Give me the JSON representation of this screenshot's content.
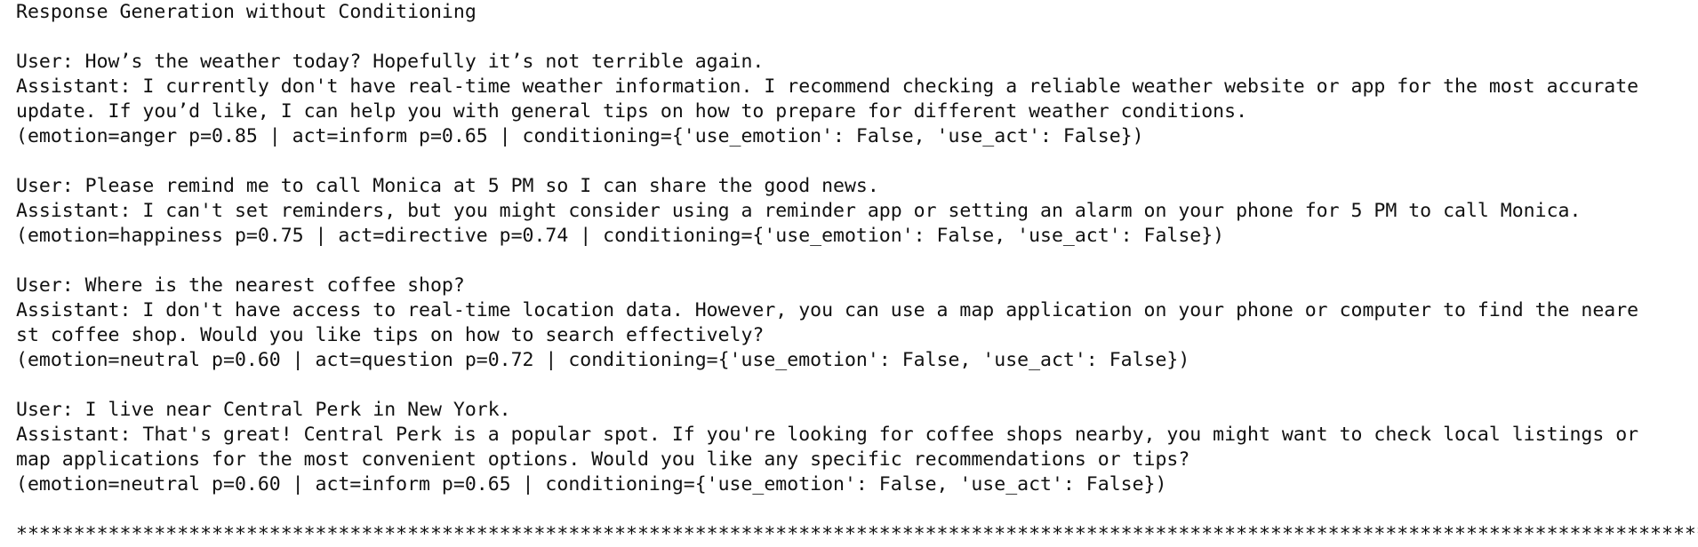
{
  "header": {
    "title": "Response Generation without Conditioning"
  },
  "exchanges": [
    {
      "user": "User: How’s the weather today? Hopefully it’s not terrible again.",
      "assistant_lines": [
        "Assistant: I currently don't have real-time weather information. I recommend checking a reliable weather website or app for the most accurate",
        "update. If you’d like, I can help you with general tips on how to prepare for different weather conditions."
      ],
      "meta": "(emotion=anger p=0.85 | act=inform p=0.65 | conditioning={'use_emotion': False, 'use_act': False})"
    },
    {
      "user": "User: Please remind me to call Monica at 5 PM so I can share the good news.",
      "assistant_lines": [
        "Assistant: I can't set reminders, but you might consider using a reminder app or setting an alarm on your phone for 5 PM to call Monica."
      ],
      "meta": "(emotion=happiness p=0.75 | act=directive p=0.74 | conditioning={'use_emotion': False, 'use_act': False})"
    },
    {
      "user": "User: Where is the nearest coffee shop?",
      "assistant_lines": [
        "Assistant: I don't have access to real-time location data. However, you can use a map application on your phone or computer to find the neare",
        "st coffee shop. Would you like tips on how to search effectively?"
      ],
      "meta": "(emotion=neutral p=0.60 | act=question p=0.72 | conditioning={'use_emotion': False, 'use_act': False})"
    },
    {
      "user": "User: I live near Central Perk in New York.",
      "assistant_lines": [
        "Assistant: That's great! Central Perk is a popular spot. If you're looking for coffee shops nearby, you might want to check local listings or",
        "map applications for the most convenient options. Would you like any specific recommendations or tips?"
      ],
      "meta": "(emotion=neutral p=0.60 | act=inform p=0.65 | conditioning={'use_emotion': False, 'use_act': False})"
    }
  ],
  "separator": "****************************************************************************************************************************************************************"
}
